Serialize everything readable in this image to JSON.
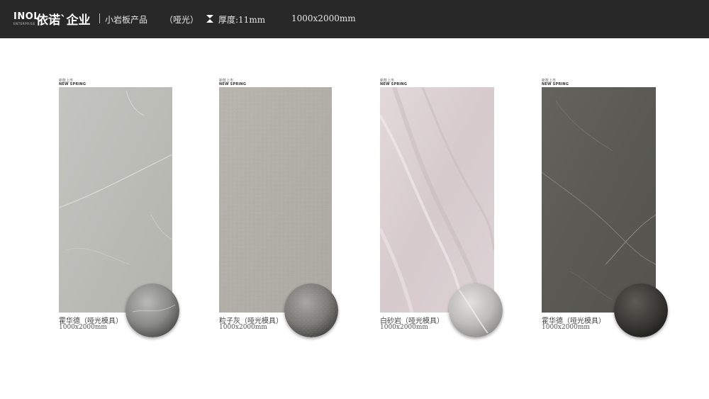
{
  "header": {
    "brand_en": "INOL",
    "brand_sub": "ENTERPRISE",
    "brand_cn": "依诺`企业",
    "product_type": "小岩板产品",
    "finish": "（哑光）",
    "thickness_icon": "thickness-icon",
    "thickness": "厚度:11mm",
    "size": "1000x2000mm"
  },
  "products": [
    {
      "tag_cn": "新款上市",
      "tag_en": "NEW SPRING",
      "name": "霍华德（哑光模具）",
      "dims": "1000x2000mm",
      "color": "#bcbcb8"
    },
    {
      "tag_cn": "新款上市",
      "tag_en": "NEW SPRING",
      "name": "粒子灰（哑光模具）",
      "dims": "1000x2000mm",
      "color": "#b3b0aa"
    },
    {
      "tag_cn": "新款上市",
      "tag_en": "NEW SPRING",
      "name": "白砂岩（哑光模具）",
      "dims": "1000x2000mm",
      "color": "#dccfd2"
    },
    {
      "tag_cn": "新款上市",
      "tag_en": "NEW SPRING",
      "name": "霍华德（哑光模具）",
      "dims": "1000x2000mm",
      "color": "#5e5d57"
    }
  ]
}
